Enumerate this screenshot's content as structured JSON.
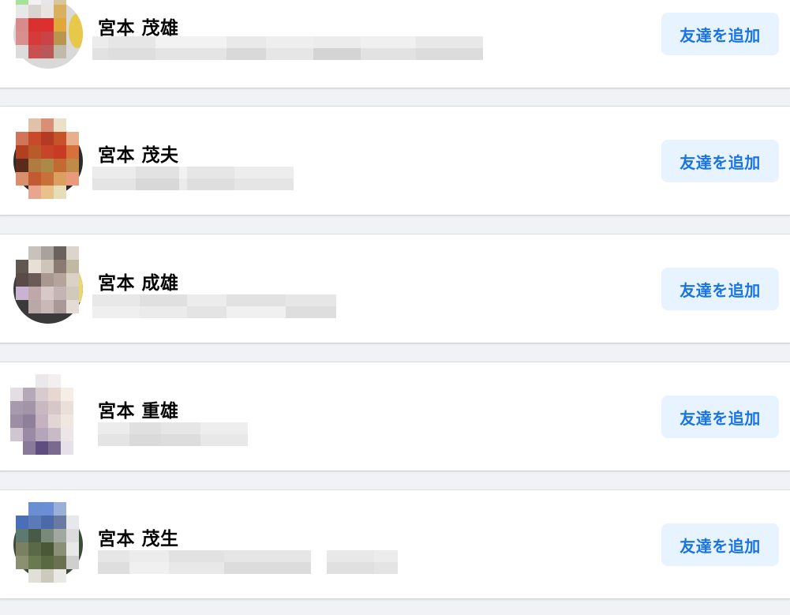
{
  "colors": {
    "page_background": "#f0f2f5",
    "card_background": "#ffffff",
    "button_background": "#e7f3ff",
    "button_text": "#1b74e4",
    "name_text": "#050505"
  },
  "add_friend_label": "友達を追加",
  "people": [
    {
      "name": "宮本 茂雄",
      "button": "友達を追加",
      "avatar": "blurred-profile-photo",
      "subtitle": "blurred"
    },
    {
      "name": "宮本 茂夫",
      "button": "友達を追加",
      "avatar": "blurred-profile-photo",
      "subtitle": "blurred"
    },
    {
      "name": "宮本 成雄",
      "button": "友達を追加",
      "avatar": "blurred-profile-photo",
      "subtitle": "blurred"
    },
    {
      "name": "宮本 重雄",
      "button": "友達を追加",
      "avatar": "blurred-profile-photo",
      "subtitle": "blurred"
    },
    {
      "name": "宮本 茂生",
      "button": "友達を追加",
      "avatar": "blurred-profile-photo",
      "subtitle": "blurred"
    }
  ]
}
